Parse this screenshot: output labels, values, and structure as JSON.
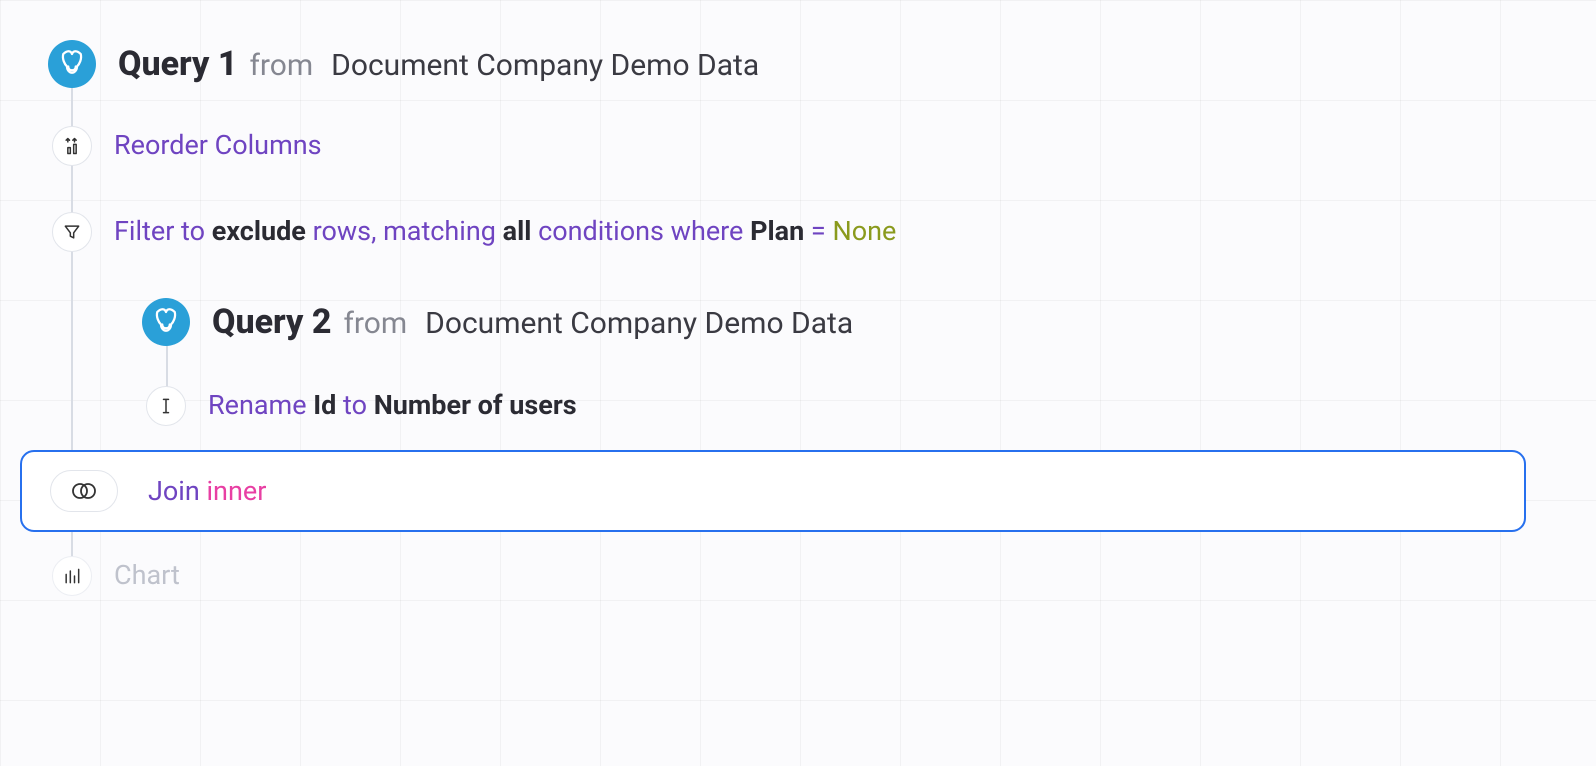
{
  "query1": {
    "title": "Query 1",
    "from_label": "from",
    "source": "Document Company Demo Data"
  },
  "reorder": {
    "label": "Reorder Columns"
  },
  "filter": {
    "prefix": "Filter to ",
    "mode": "exclude",
    "mid1": " rows, matching ",
    "match": "all",
    "mid2": " conditions where ",
    "column": "Plan",
    "eq": " = ",
    "value": "None"
  },
  "query2": {
    "title": "Query 2",
    "from_label": "from",
    "source": "Document Company Demo Data"
  },
  "rename": {
    "prefix": "Rename ",
    "from_col": "Id",
    "mid": " to ",
    "to_col": "Number of users"
  },
  "join": {
    "label": "Join ",
    "type": "inner"
  },
  "chart": {
    "label": "Chart"
  }
}
